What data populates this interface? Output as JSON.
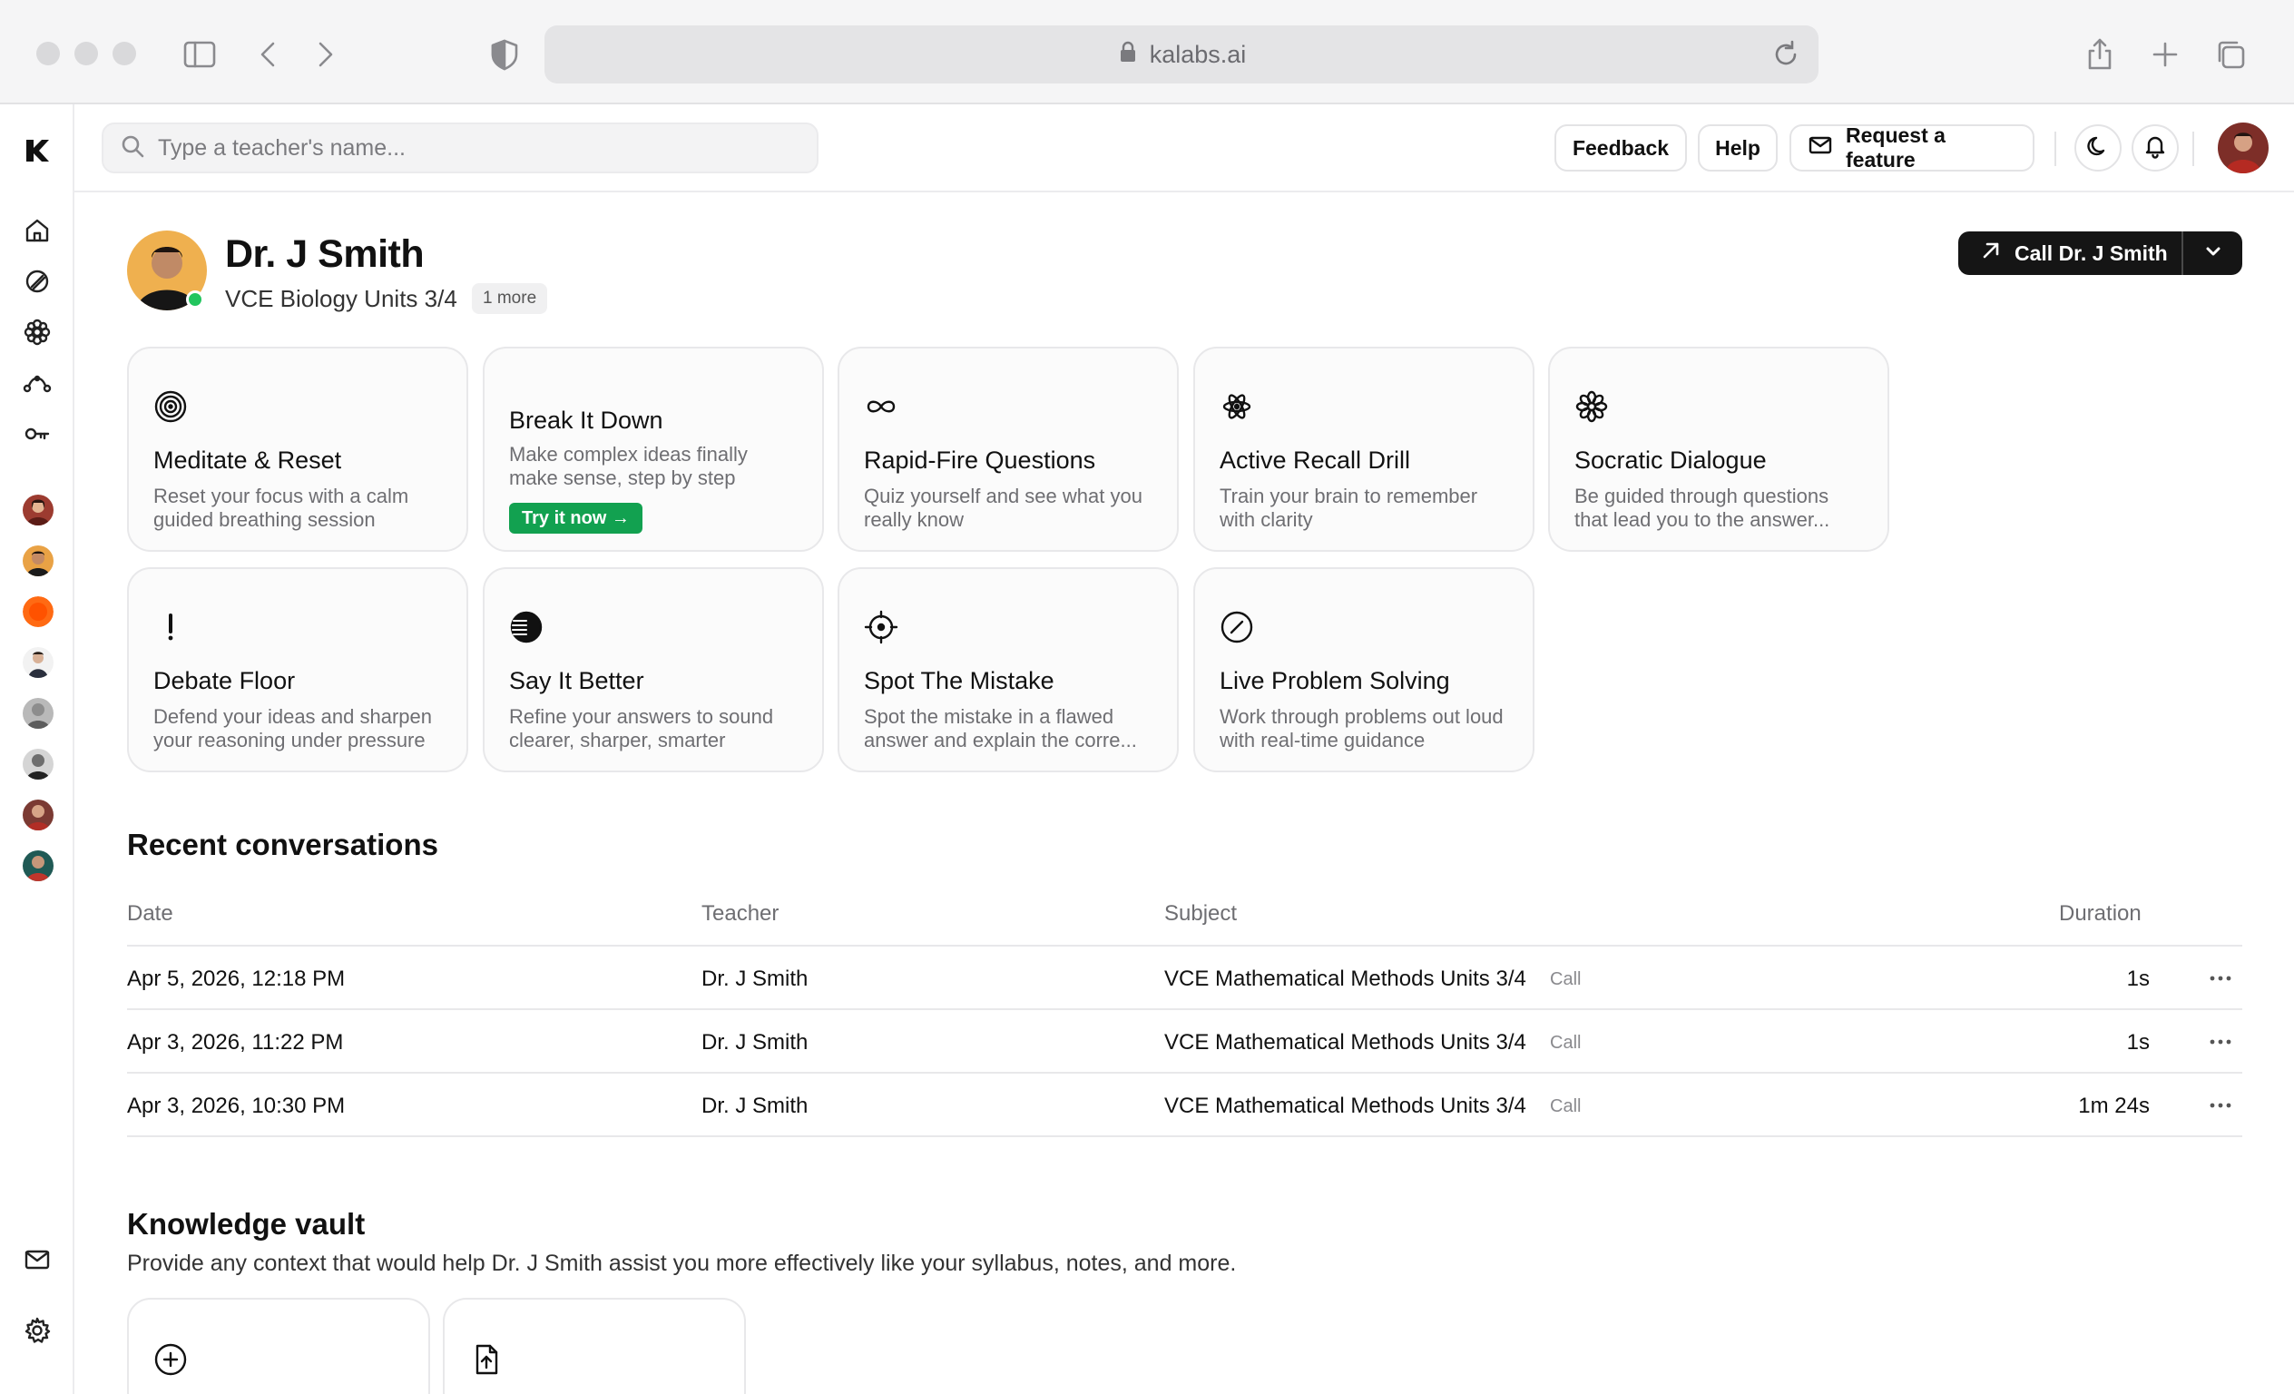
{
  "browser": {
    "url": "kalabs.ai"
  },
  "search": {
    "placeholder": "Type a teacher's name..."
  },
  "topbar": {
    "feedback": "Feedback",
    "help": "Help",
    "request_feature": "Request a feature"
  },
  "profile": {
    "name": "Dr. J Smith",
    "subject": "VCE Biology Units 3/4",
    "more": "1 more",
    "call_button": "Call Dr. J Smith",
    "status": "online"
  },
  "modes": [
    {
      "title": "Meditate & Reset",
      "description": "Reset your focus with a calm guided breathing session",
      "icon": "target-rings-icon"
    },
    {
      "title": "Break It Down",
      "description": "Make complex ideas finally make sense, step by step",
      "cta": "Try it now →",
      "featured": true
    },
    {
      "title": "Rapid-Fire Questions",
      "description": "Quiz yourself and see what you really know",
      "icon": "infinity-icon"
    },
    {
      "title": "Active Recall Drill",
      "description": "Train your brain to remember with clarity",
      "icon": "atom-icon"
    },
    {
      "title": "Socratic Dialogue",
      "description": "Be guided through questions that lead you to the answer...",
      "icon": "flower-icon"
    },
    {
      "title": "Debate Floor",
      "description": "Defend your ideas and sharpen your reasoning under pressure",
      "icon": "exclamation-icon"
    },
    {
      "title": "Say It Better",
      "description": "Refine your answers to sound clearer, sharper, smarter",
      "icon": "striped-circle-icon"
    },
    {
      "title": "Spot The Mistake",
      "description": "Spot the mistake in a flawed answer and explain the corre...",
      "icon": "crosshair-icon"
    },
    {
      "title": "Live Problem Solving",
      "description": "Work through problems out loud with real-time guidance",
      "icon": "slashed-circle-icon"
    }
  ],
  "recent": {
    "title": "Recent conversations",
    "columns": {
      "date": "Date",
      "teacher": "Teacher",
      "subject": "Subject",
      "duration": "Duration"
    },
    "rows": [
      {
        "date": "Apr 5, 2026, 12:18 PM",
        "teacher": "Dr. J Smith",
        "subject": "VCE Mathematical Methods Units 3/4",
        "type": "Call",
        "duration": "1s"
      },
      {
        "date": "Apr 3, 2026, 11:22 PM",
        "teacher": "Dr. J Smith",
        "subject": "VCE Mathematical Methods Units 3/4",
        "type": "Call",
        "duration": "1s"
      },
      {
        "date": "Apr 3, 2026, 10:30 PM",
        "teacher": "Dr. J Smith",
        "subject": "VCE Mathematical Methods Units 3/4",
        "type": "Call",
        "duration": "1m 24s"
      }
    ]
  },
  "vault": {
    "title": "Knowledge vault",
    "description": "Provide any context that would help Dr. J Smith assist you more effectively like your syllabus, notes, and more."
  },
  "colors": {
    "accent_green": "#12a150",
    "online": "#22c55e",
    "call_button": "#151515"
  }
}
